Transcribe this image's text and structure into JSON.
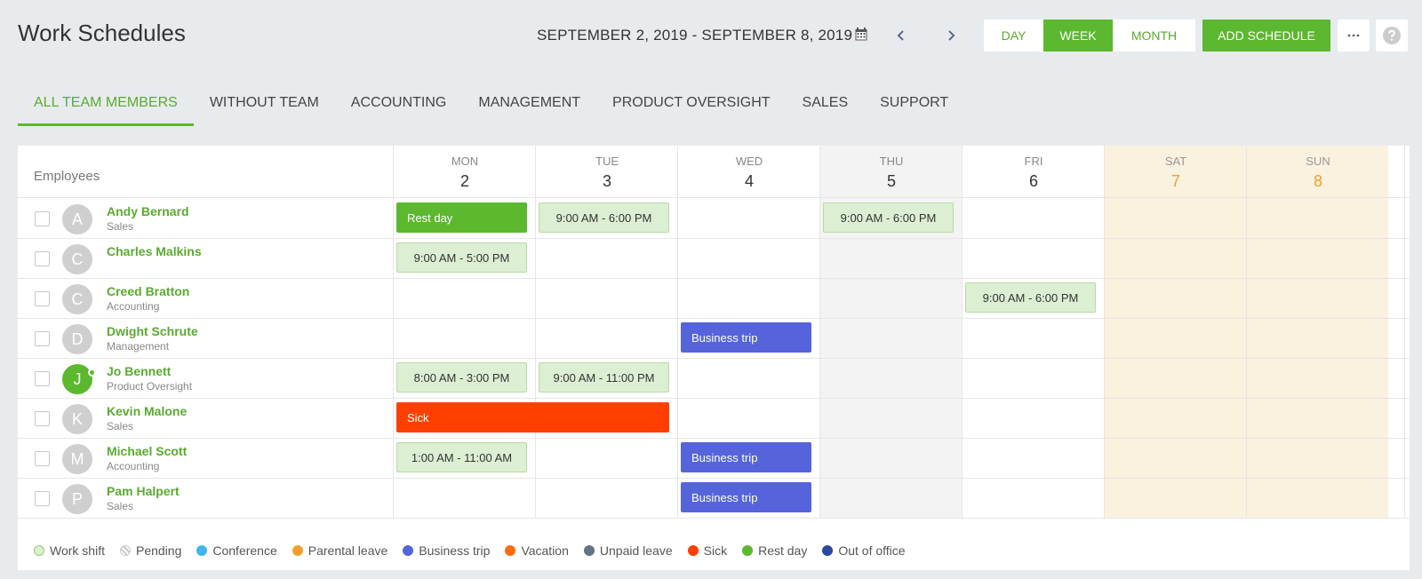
{
  "header": {
    "title": "Work Schedules",
    "date_range": "SEPTEMBER 2, 2019 - SEPTEMBER 8, 2019",
    "view_buttons": {
      "day": "DAY",
      "week": "WEEK",
      "month": "MONTH"
    },
    "active_view": "WEEK",
    "add_schedule": "ADD SCHEDULE",
    "accent_color": "#5cb82e"
  },
  "tabs": [
    {
      "label": "ALL TEAM MEMBERS",
      "active": true
    },
    {
      "label": "WITHOUT TEAM"
    },
    {
      "label": "ACCOUNTING"
    },
    {
      "label": "MANAGEMENT"
    },
    {
      "label": "PRODUCT OVERSIGHT"
    },
    {
      "label": "SALES"
    },
    {
      "label": "SUPPORT"
    }
  ],
  "grid": {
    "employees_label": "Employees",
    "days": [
      {
        "name": "MON",
        "num": "2"
      },
      {
        "name": "TUE",
        "num": "3"
      },
      {
        "name": "WED",
        "num": "4"
      },
      {
        "name": "THU",
        "num": "5",
        "today": true
      },
      {
        "name": "FRI",
        "num": "6"
      },
      {
        "name": "SAT",
        "num": "7",
        "weekend": true
      },
      {
        "name": "SUN",
        "num": "8",
        "weekend": true
      }
    ],
    "employees": [
      {
        "initial": "A",
        "name": "Andy Bernard",
        "team": "Sales"
      },
      {
        "initial": "C",
        "name": "Charles Malkins",
        "team": ""
      },
      {
        "initial": "C",
        "name": "Creed Bratton",
        "team": "Accounting"
      },
      {
        "initial": "D",
        "name": "Dwight Schrute",
        "team": "Management"
      },
      {
        "initial": "J",
        "name": "Jo Bennett",
        "team": "Product Oversight",
        "online": true
      },
      {
        "initial": "K",
        "name": "Kevin Malone",
        "team": "Sales"
      },
      {
        "initial": "M",
        "name": "Michael Scott",
        "team": "Accounting"
      },
      {
        "initial": "P",
        "name": "Pam Halpert",
        "team": "Sales"
      }
    ],
    "events": {
      "andy_mon": "Rest day",
      "andy_tue": "9:00 AM - 6:00 PM",
      "andy_thu": "9:00 AM - 6:00 PM",
      "charles_mon": "9:00 AM - 5:00 PM",
      "creed_fri": "9:00 AM - 6:00 PM",
      "dwight_wed": "Business trip",
      "jo_mon": "8:00 AM - 3:00 PM",
      "jo_tue": "9:00 AM - 11:00 PM",
      "kevin_mon_tue": "Sick",
      "michael_mon": "1:00 AM - 11:00 AM",
      "michael_wed": "Business trip",
      "pam_wed": "Business trip"
    }
  },
  "legend": [
    {
      "label": "Work shift",
      "color": "#dcefd3"
    },
    {
      "label": "Pending",
      "color": "#c9c9c9"
    },
    {
      "label": "Conference",
      "color": "#3eb6f0"
    },
    {
      "label": "Parental leave",
      "color": "#f0a030"
    },
    {
      "label": "Business trip",
      "color": "#5664dc"
    },
    {
      "label": "Vacation",
      "color": "#ff6a10"
    },
    {
      "label": "Unpaid leave",
      "color": "#5f7585"
    },
    {
      "label": "Sick",
      "color": "#ff3f00"
    },
    {
      "label": "Rest day",
      "color": "#5cb82e"
    },
    {
      "label": "Out of office",
      "color": "#2b4a9a"
    }
  ]
}
